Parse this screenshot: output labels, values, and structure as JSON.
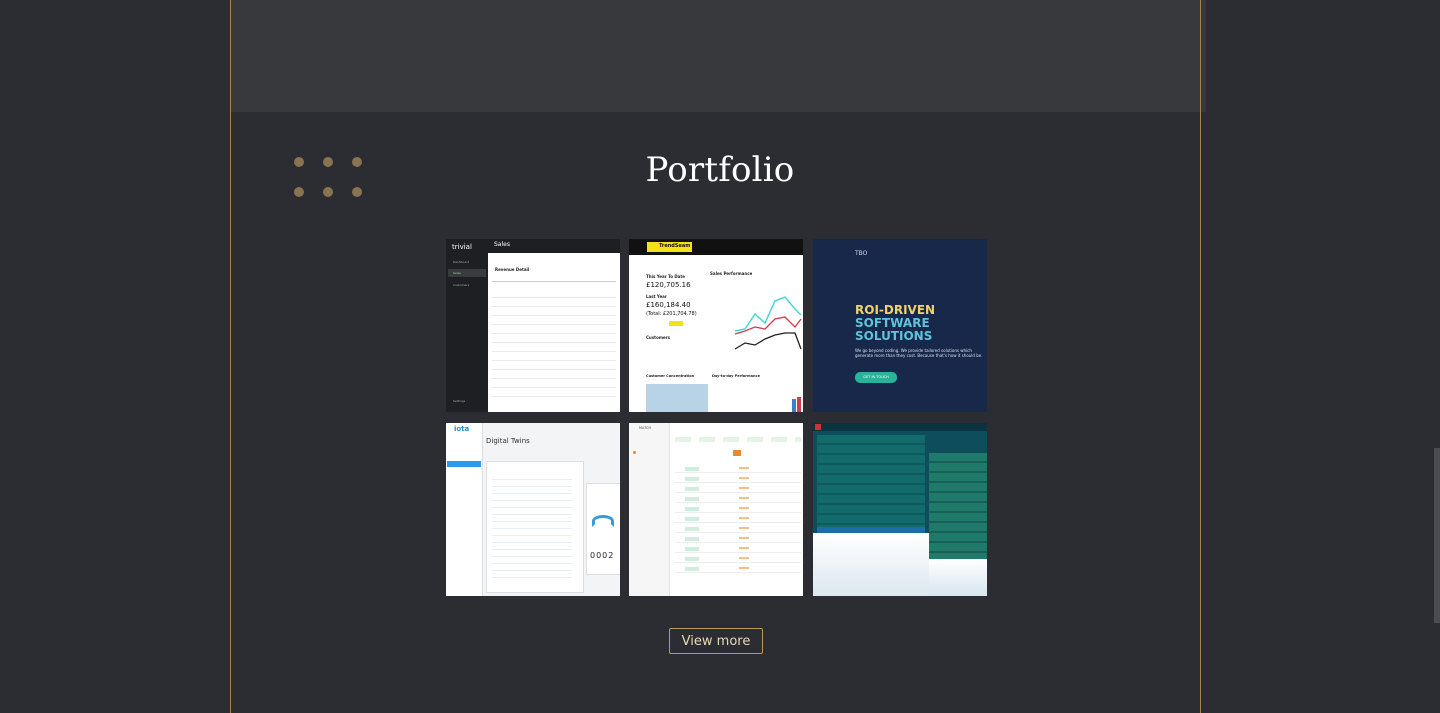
{
  "section": {
    "title": "Portfolio",
    "view_more_label": "View more"
  },
  "portfolio": {
    "tiles": [
      {
        "name": "trivial-sales",
        "brand": "trivial",
        "heading": "Sales",
        "subheading": "Revenue Detail",
        "nav": [
          "Dashboard",
          "Sales",
          "Customers"
        ],
        "footer_nav": "Settings"
      },
      {
        "name": "trendseam",
        "brand": "TrendSeam",
        "kpis": [
          "This Year To Date",
          "£120,705.16",
          "Last Year",
          "£160,184.40",
          "(Total: £201,704.78)"
        ],
        "panels": [
          "Sales Performance",
          "Customers",
          "Customer Concentration",
          "Day-to-day Performance"
        ]
      },
      {
        "name": "tbo-roi",
        "brand": "TBO",
        "headline_lines": [
          "ROI-DRIVEN",
          "SOFTWARE",
          "SOLUTIONS"
        ],
        "body": "We go beyond coding. We provide tailored solutions which generate more than they cost. Because that's how it should be.",
        "cta": "GET IN TOUCH"
      },
      {
        "name": "iota-digital-twins",
        "brand": "iota",
        "heading": "Digital Twins",
        "counter": "0002"
      },
      {
        "name": "match-table",
        "brand": "MATCH"
      },
      {
        "name": "trading-dashboard",
        "brand": ""
      }
    ]
  },
  "colors": {
    "background": "#2b2d32",
    "band": "#38393d",
    "accent": "#b99a5c",
    "title": "#ffffff"
  }
}
